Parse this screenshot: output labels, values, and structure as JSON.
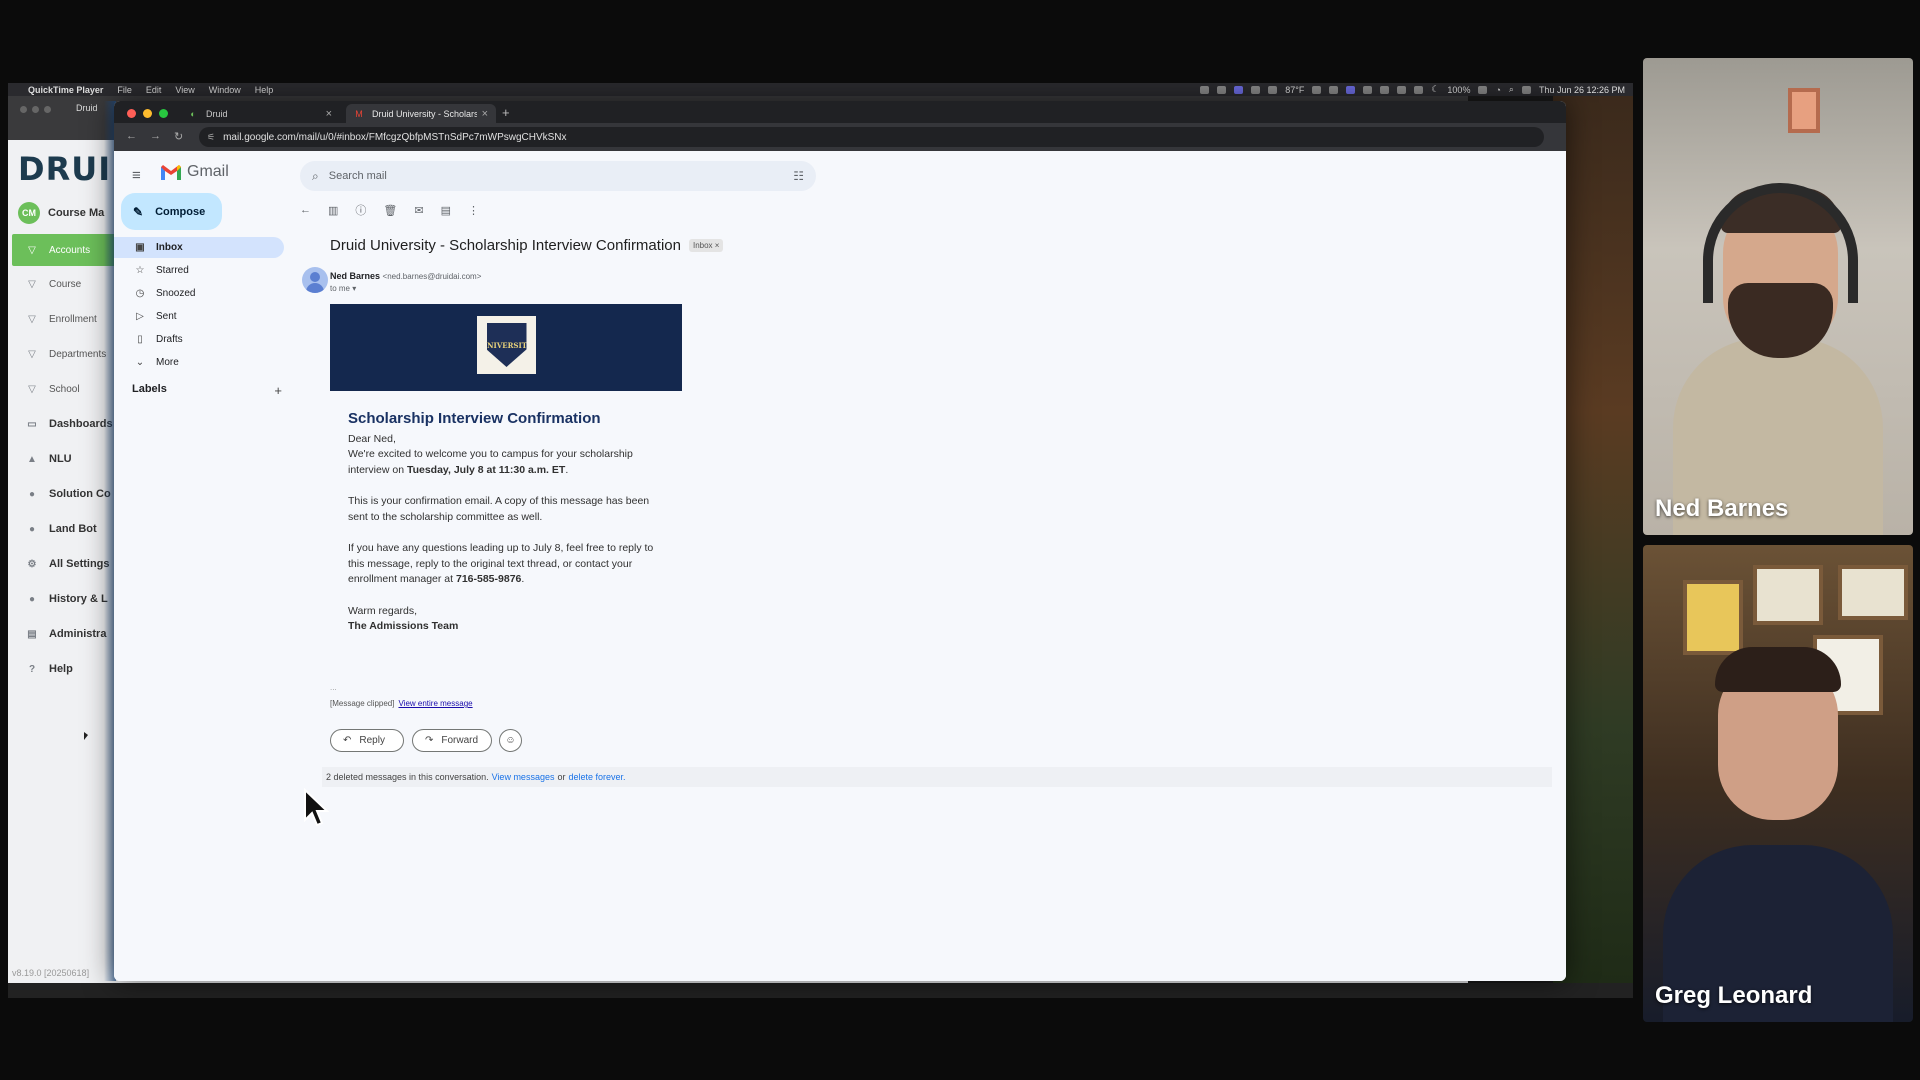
{
  "mac_menubar": {
    "app_name": "QuickTime Player",
    "menus": [
      "File",
      "Edit",
      "View",
      "Window",
      "Help"
    ],
    "status_text": "87°F",
    "battery": "100%",
    "clock": "Thu Jun 26  12:26 PM"
  },
  "druid_app": {
    "tab_label": "Druid",
    "logo": "DRUID",
    "user_initials": "CM",
    "user_name": "Course Ma",
    "items": [
      {
        "label": "Accounts",
        "icon": "funnel-icon"
      },
      {
        "label": "Course",
        "icon": "funnel-icon"
      },
      {
        "label": "Enrollment",
        "icon": "funnel-icon"
      },
      {
        "label": "Departments",
        "icon": "funnel-icon"
      },
      {
        "label": "School",
        "icon": "funnel-icon"
      },
      {
        "label": "Dashboards",
        "icon": "dashboard-icon"
      },
      {
        "label": "NLU",
        "icon": "graduation-cap-icon"
      },
      {
        "label": "Solution Co",
        "icon": "person-icon"
      },
      {
        "label": "Land Bot",
        "icon": "person-icon"
      },
      {
        "label": "All Settings",
        "icon": "gear-icon"
      },
      {
        "label": "History & L",
        "icon": "person-icon"
      },
      {
        "label": "Administra",
        "icon": "table-icon"
      },
      {
        "label": "Help",
        "icon": "help-icon"
      }
    ],
    "version": "v8.19.0 [20250618]"
  },
  "browser": {
    "tabs": [
      {
        "label": "Druid"
      },
      {
        "label": "Druid University - Scholarshi"
      }
    ],
    "url": "mail.google.com/mail/u/0/#inbox/FMfcgzQbfpMSTnSdPc7mWPswgCHVkSNx"
  },
  "gmail": {
    "brand": "Gmail",
    "search_placeholder": "Search mail",
    "compose_label": "Compose",
    "nav": [
      {
        "label": "Inbox",
        "icon": "inbox-icon",
        "active": true
      },
      {
        "label": "Starred",
        "icon": "star-icon"
      },
      {
        "label": "Snoozed",
        "icon": "clock-icon"
      },
      {
        "label": "Sent",
        "icon": "send-icon"
      },
      {
        "label": "Drafts",
        "icon": "draft-icon"
      },
      {
        "label": "More",
        "icon": "chevron-down-icon"
      }
    ],
    "labels_heading": "Labels",
    "message": {
      "subject": "Druid University - Scholarship Interview Confirmation",
      "chip": "Inbox ×",
      "sender_name": "Ned Barnes",
      "sender_email": "<ned.barnes@druidai.com>",
      "to": "to me ▾",
      "crest_text": "UNIVERSITY",
      "heading": "Scholarship Interview Confirmation",
      "greeting": "Dear Ned,",
      "p1_text": "We're excited to welcome you to campus for your scholarship interview on ",
      "p1_bold": "Tuesday, July 8 at 11:30 a.m. ET",
      "p1_end": ".",
      "p2": "This is your confirmation email. A copy of this message has been sent to the scholarship committee as well.",
      "p3_text": "If you have any questions leading up to July 8, feel free to reply to this message, reply to the original text thread, or contact your enrollment manager at ",
      "p3_bold": "716-585-9876",
      "p3_end": ".",
      "closing": "Warm regards,",
      "signature": "The Admissions Team",
      "ellipsis": "...",
      "clipped": "[Message clipped]",
      "view_entire": "View entire message",
      "reply_label": "Reply",
      "forward_label": "Forward",
      "deleted_text": "2 deleted messages in this conversation.",
      "view_messages": "View messages",
      "or": "or",
      "delete_forever": "delete forever."
    }
  },
  "participants": [
    {
      "name": "Ned Barnes"
    },
    {
      "name": "Greg Leonard"
    }
  ],
  "colors": {
    "druid_green": "#6cbf5a",
    "gmail_compose": "#c2e7ff",
    "gmail_active": "#d3e3fd",
    "email_banner": "#14284e",
    "email_heading": "#1a3263"
  }
}
